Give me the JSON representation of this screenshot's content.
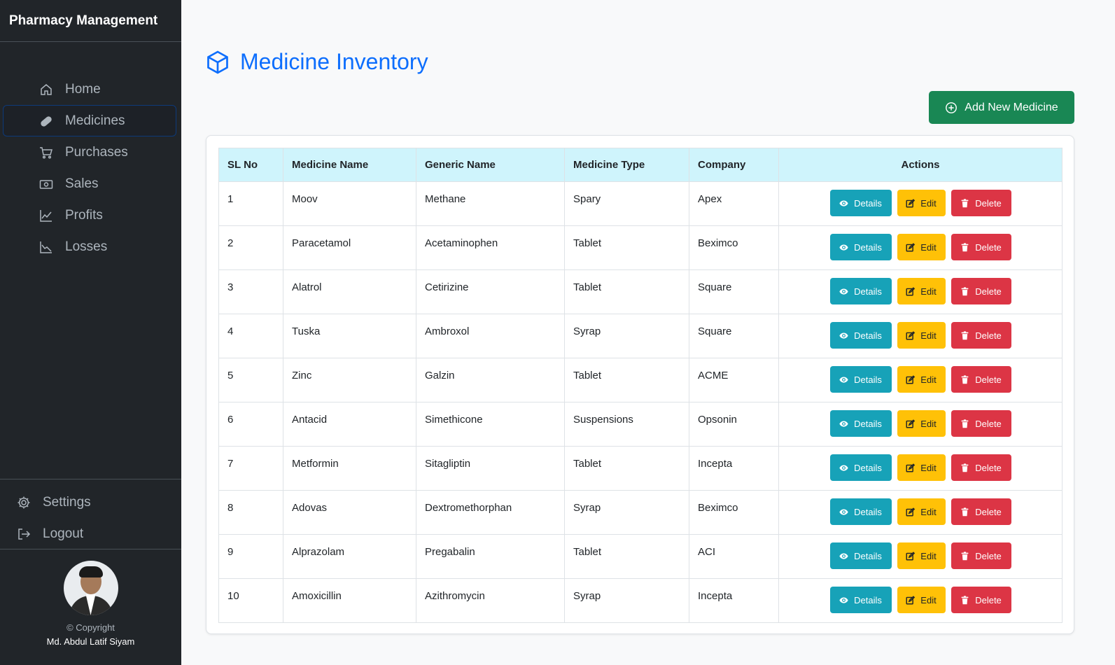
{
  "app": {
    "title": "Pharmacy Management"
  },
  "sidebar": {
    "items": [
      {
        "label": "Home",
        "icon": "home-icon"
      },
      {
        "label": "Medicines",
        "icon": "pill-icon",
        "active": true
      },
      {
        "label": "Purchases",
        "icon": "cart-icon"
      },
      {
        "label": "Sales",
        "icon": "cash-icon"
      },
      {
        "label": "Profits",
        "icon": "graph-up-icon"
      },
      {
        "label": "Losses",
        "icon": "graph-down-icon"
      }
    ],
    "bottom_items": [
      {
        "label": "Settings",
        "icon": "gear-icon"
      },
      {
        "label": "Logout",
        "icon": "logout-icon"
      }
    ],
    "footer": {
      "copyright": "© Copyright",
      "author": "Md. Abdul Latif Siyam"
    }
  },
  "main": {
    "title": "Medicine Inventory",
    "title_icon": "box-icon",
    "add_button": "Add New Medicine",
    "table": {
      "headers": [
        "SL No",
        "Medicine Name",
        "Generic Name",
        "Medicine Type",
        "Company",
        "Actions"
      ],
      "actions": {
        "details": "Details",
        "edit": "Edit",
        "delete": "Delete"
      },
      "rows": [
        [
          "1",
          "Moov",
          "Methane",
          "Spary",
          "Apex"
        ],
        [
          "2",
          "Paracetamol",
          "Acetaminophen",
          "Tablet",
          "Beximco"
        ],
        [
          "3",
          "Alatrol",
          "Cetirizine",
          "Tablet",
          "Square"
        ],
        [
          "4",
          "Tuska",
          "Ambroxol",
          "Syrap",
          "Square"
        ],
        [
          "5",
          "Zinc",
          "Galzin",
          "Tablet",
          "ACME"
        ],
        [
          "6",
          "Antacid",
          "Simethicone",
          "Suspensions",
          "Opsonin"
        ],
        [
          "7",
          "Metformin",
          "Sitagliptin",
          "Tablet",
          "Incepta"
        ],
        [
          "8",
          "Adovas",
          "Dextromethorphan",
          "Syrap",
          "Beximco"
        ],
        [
          "9",
          "Alprazolam",
          "Pregabalin",
          "Tablet",
          "ACI"
        ],
        [
          "10",
          "Amoxicillin",
          "Azithromycin",
          "Syrap",
          "Incepta"
        ]
      ]
    }
  },
  "colors": {
    "sidebar_bg": "#212529",
    "primary": "#0d6efd",
    "success": "#198754",
    "info": "#17a2b8",
    "warning": "#ffc107",
    "danger": "#dc3545",
    "table_header_bg": "#cff4fc"
  }
}
